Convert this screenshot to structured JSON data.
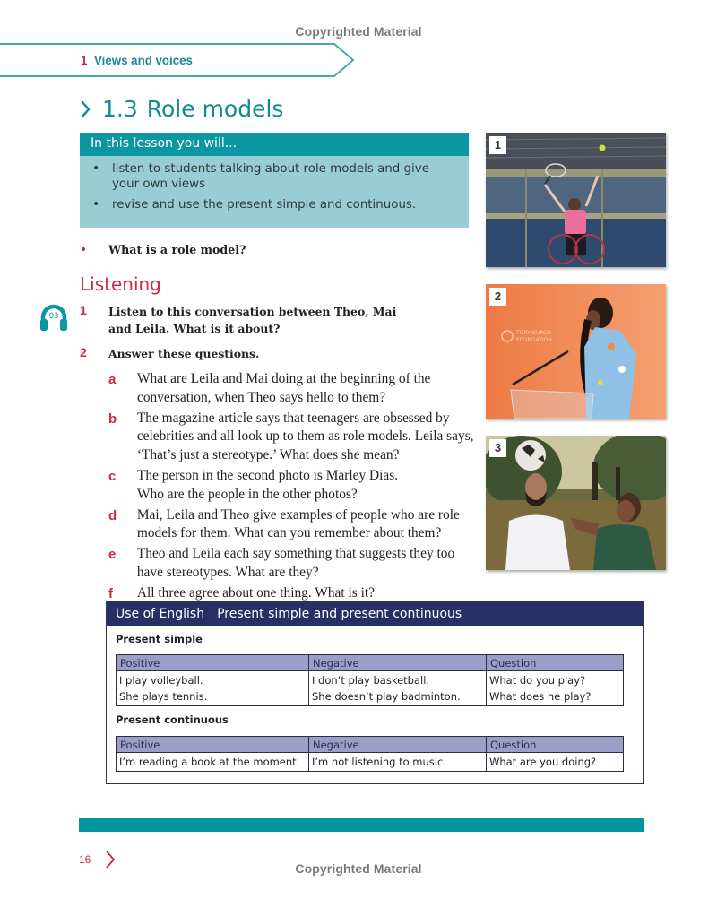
{
  "watermark": "Copyrighted Material",
  "chapter": {
    "number": "1",
    "title": "Views and voices"
  },
  "lesson": {
    "number": "1.3",
    "title": "Role models"
  },
  "objectives": {
    "heading": "In this lesson you will...",
    "items": [
      "listen to students talking about role models and give your own views",
      "revise and use the present simple and continuous."
    ]
  },
  "warmup_question": "What is a role model?",
  "section": "Listening",
  "audio_track": "03",
  "exercises": [
    {
      "number": "1",
      "text": "Listen to this conversation between Theo, Mai and Leila. What is it about?"
    },
    {
      "number": "2",
      "text": "Answer these questions."
    }
  ],
  "questions": [
    {
      "letter": "a",
      "text": "What are Leila and Mai doing at the beginning of the conversation, when Theo says hello to them?"
    },
    {
      "letter": "b",
      "text": "The magazine article says that teenagers are obsessed by celebrities and all look up to them as role models. Leila says, ‘That’s just a stereotype.’ What does she mean?"
    },
    {
      "letter": "c",
      "text": "The person in the second photo is Marley Dias. Who are the people in the other photos?"
    },
    {
      "letter": "d",
      "text": "Mai, Leila and Theo give examples of people who are role models for them. What can you remember about them?"
    },
    {
      "letter": "e",
      "text": "Theo and Leila each say something that suggests they too have stereotypes. What are they?"
    },
    {
      "letter": "f",
      "text": "All three agree about one thing. What is it?"
    }
  ],
  "photos": [
    {
      "number": "1",
      "description": "Wheelchair tennis player serving in an indoor court"
    },
    {
      "number": "2",
      "description": "Girl speaking at a podium in front of an orange backdrop",
      "backdrop_text": "TORY BURCH FOUNDATION"
    },
    {
      "number": "3",
      "description": "Man balancing a football on his head beside a boy in a park"
    }
  ],
  "use_of_english": {
    "label": "Use of English",
    "title": "Present simple and present continuous",
    "tables": [
      {
        "heading": "Present simple",
        "columns": [
          "Positive",
          "Negative",
          "Question"
        ],
        "rows": [
          [
            "I play volleyball.",
            "I don’t play basketball.",
            "What do you play?"
          ],
          [
            "She plays tennis.",
            "She doesn’t play badminton.",
            "What does he play?"
          ]
        ]
      },
      {
        "heading": "Present continuous",
        "columns": [
          "Positive",
          "Negative",
          "Question"
        ],
        "rows": [
          [
            "I’m reading a book at the moment.",
            "I’m not listening to music.",
            "What are you doing?"
          ]
        ]
      }
    ]
  },
  "page_number": "16",
  "colors": {
    "teal": "#0b96a1",
    "teal_light": "#98cdd3",
    "red": "#cf2a42",
    "navy": "#273064",
    "table_header": "#9a9ec8"
  }
}
